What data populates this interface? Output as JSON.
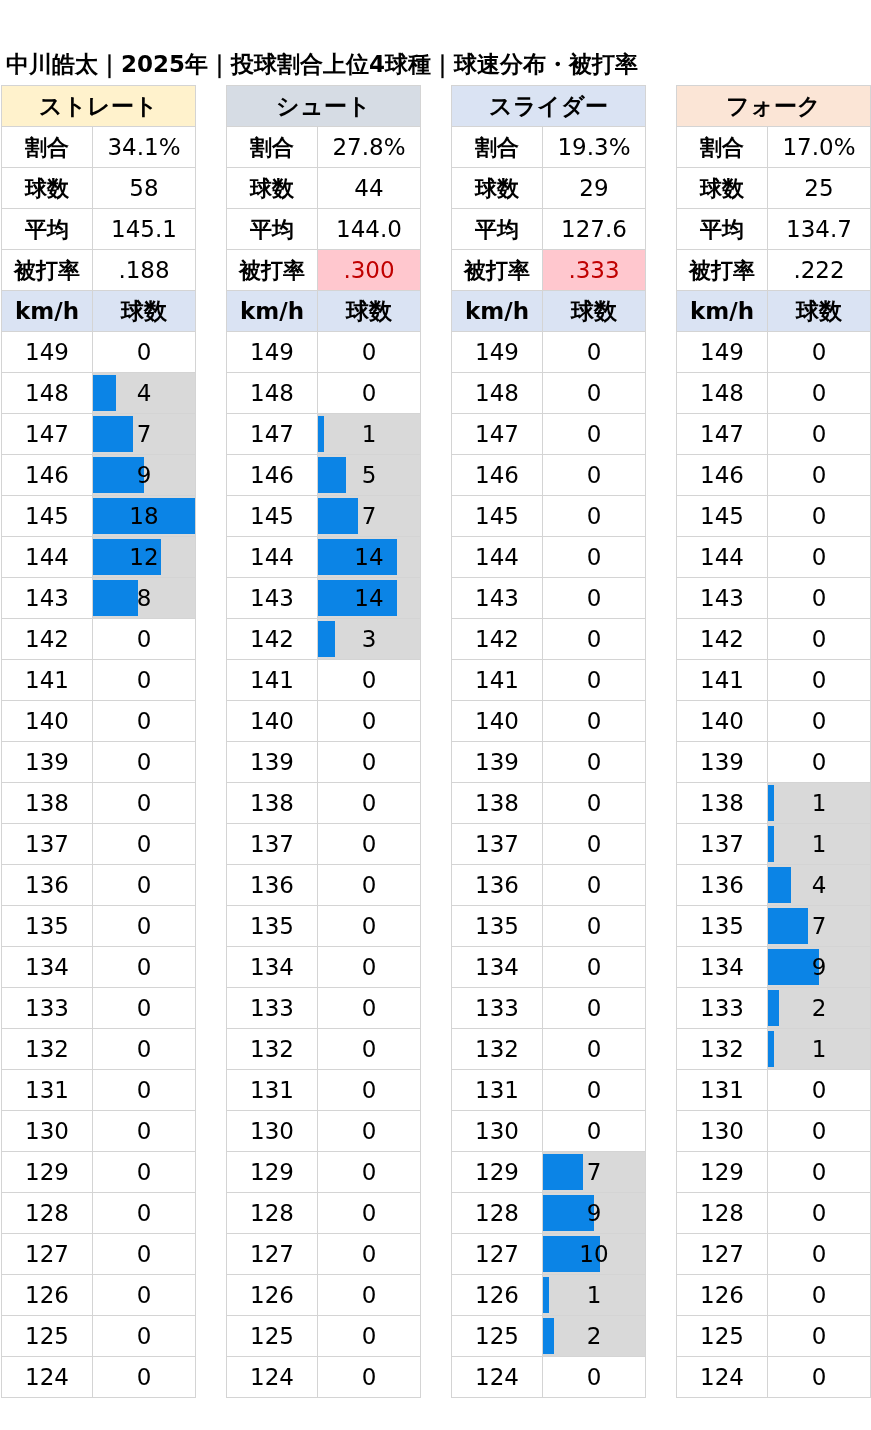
{
  "title": "中川皓太｜2025年｜投球割合上位4球種｜球速分布・被打率",
  "pitches": [
    {
      "name": "ストレート",
      "color": "#fff2cc",
      "stats": [
        {
          "label": "割合",
          "value": "34.1%",
          "highlight": false
        },
        {
          "label": "球数",
          "value": "58",
          "highlight": false
        },
        {
          "label": "平均",
          "value": "145.1",
          "highlight": false
        },
        {
          "label": "被打率",
          "value": ".188",
          "highlight": false
        }
      ],
      "columns": [
        "km/h",
        "球数"
      ],
      "rows": [
        {
          "speed": "149",
          "count": "0"
        },
        {
          "speed": "148",
          "count": "4",
          "level": 0.222
        },
        {
          "speed": "147",
          "count": "7",
          "level": 0.389
        },
        {
          "speed": "146",
          "count": "9",
          "level": 0.5
        },
        {
          "speed": "145",
          "count": "18",
          "level": 1
        },
        {
          "speed": "144",
          "count": "12",
          "level": 0.667
        },
        {
          "speed": "143",
          "count": "8",
          "level": 0.444
        },
        {
          "speed": "142",
          "count": "0"
        },
        {
          "speed": "141",
          "count": "0"
        },
        {
          "speed": "140",
          "count": "0"
        },
        {
          "speed": "139",
          "count": "0"
        },
        {
          "speed": "138",
          "count": "0"
        },
        {
          "speed": "137",
          "count": "0"
        },
        {
          "speed": "136",
          "count": "0"
        },
        {
          "speed": "135",
          "count": "0"
        },
        {
          "speed": "134",
          "count": "0"
        },
        {
          "speed": "133",
          "count": "0"
        },
        {
          "speed": "132",
          "count": "0"
        },
        {
          "speed": "131",
          "count": "0"
        },
        {
          "speed": "130",
          "count": "0"
        },
        {
          "speed": "129",
          "count": "0"
        },
        {
          "speed": "128",
          "count": "0"
        },
        {
          "speed": "127",
          "count": "0"
        },
        {
          "speed": "126",
          "count": "0"
        },
        {
          "speed": "125",
          "count": "0"
        },
        {
          "speed": "124",
          "count": "0"
        }
      ]
    },
    {
      "name": "シュート",
      "color": "#d6dce4",
      "stats": [
        {
          "label": "割合",
          "value": "27.8%",
          "highlight": false
        },
        {
          "label": "球数",
          "value": "44",
          "highlight": false
        },
        {
          "label": "平均",
          "value": "144.0",
          "highlight": false
        },
        {
          "label": "被打率",
          "value": ".300",
          "highlight": true
        }
      ],
      "columns": [
        "km/h",
        "球数"
      ],
      "rows": [
        {
          "speed": "149",
          "count": "0"
        },
        {
          "speed": "148",
          "count": "0"
        },
        {
          "speed": "147",
          "count": "1",
          "level": 0.056
        },
        {
          "speed": "146",
          "count": "5",
          "level": 0.278
        },
        {
          "speed": "145",
          "count": "7",
          "level": 0.389
        },
        {
          "speed": "144",
          "count": "14",
          "level": 0.778
        },
        {
          "speed": "143",
          "count": "14",
          "level": 0.778
        },
        {
          "speed": "142",
          "count": "3",
          "level": 0.167
        },
        {
          "speed": "141",
          "count": "0"
        },
        {
          "speed": "140",
          "count": "0"
        },
        {
          "speed": "139",
          "count": "0"
        },
        {
          "speed": "138",
          "count": "0"
        },
        {
          "speed": "137",
          "count": "0"
        },
        {
          "speed": "136",
          "count": "0"
        },
        {
          "speed": "135",
          "count": "0"
        },
        {
          "speed": "134",
          "count": "0"
        },
        {
          "speed": "133",
          "count": "0"
        },
        {
          "speed": "132",
          "count": "0"
        },
        {
          "speed": "131",
          "count": "0"
        },
        {
          "speed": "130",
          "count": "0"
        },
        {
          "speed": "129",
          "count": "0"
        },
        {
          "speed": "128",
          "count": "0"
        },
        {
          "speed": "127",
          "count": "0"
        },
        {
          "speed": "126",
          "count": "0"
        },
        {
          "speed": "125",
          "count": "0"
        },
        {
          "speed": "124",
          "count": "0"
        }
      ]
    },
    {
      "name": "スライダー",
      "color": "#dae3f3",
      "stats": [
        {
          "label": "割合",
          "value": "19.3%",
          "highlight": false
        },
        {
          "label": "球数",
          "value": "29",
          "highlight": false
        },
        {
          "label": "平均",
          "value": "127.6",
          "highlight": false
        },
        {
          "label": "被打率",
          "value": ".333",
          "highlight": true
        }
      ],
      "columns": [
        "km/h",
        "球数"
      ],
      "rows": [
        {
          "speed": "149",
          "count": "0"
        },
        {
          "speed": "148",
          "count": "0"
        },
        {
          "speed": "147",
          "count": "0"
        },
        {
          "speed": "146",
          "count": "0"
        },
        {
          "speed": "145",
          "count": "0"
        },
        {
          "speed": "144",
          "count": "0"
        },
        {
          "speed": "143",
          "count": "0"
        },
        {
          "speed": "142",
          "count": "0"
        },
        {
          "speed": "141",
          "count": "0"
        },
        {
          "speed": "140",
          "count": "0"
        },
        {
          "speed": "139",
          "count": "0"
        },
        {
          "speed": "138",
          "count": "0"
        },
        {
          "speed": "137",
          "count": "0"
        },
        {
          "speed": "136",
          "count": "0"
        },
        {
          "speed": "135",
          "count": "0"
        },
        {
          "speed": "134",
          "count": "0"
        },
        {
          "speed": "133",
          "count": "0"
        },
        {
          "speed": "132",
          "count": "0"
        },
        {
          "speed": "131",
          "count": "0"
        },
        {
          "speed": "130",
          "count": "0"
        },
        {
          "speed": "129",
          "count": "7",
          "level": 0.389
        },
        {
          "speed": "128",
          "count": "9",
          "level": 0.5
        },
        {
          "speed": "127",
          "count": "10",
          "level": 0.556
        },
        {
          "speed": "126",
          "count": "1",
          "level": 0.056
        },
        {
          "speed": "125",
          "count": "2",
          "level": 0.111
        },
        {
          "speed": "124",
          "count": "0"
        }
      ]
    },
    {
      "name": "フォーク",
      "color": "#fbe5d6",
      "stats": [
        {
          "label": "割合",
          "value": "17.0%",
          "highlight": false
        },
        {
          "label": "球数",
          "value": "25",
          "highlight": false
        },
        {
          "label": "平均",
          "value": "134.7",
          "highlight": false
        },
        {
          "label": "被打率",
          "value": ".222",
          "highlight": false
        }
      ],
      "columns": [
        "km/h",
        "球数"
      ],
      "rows": [
        {
          "speed": "149",
          "count": "0"
        },
        {
          "speed": "148",
          "count": "0"
        },
        {
          "speed": "147",
          "count": "0"
        },
        {
          "speed": "146",
          "count": "0"
        },
        {
          "speed": "145",
          "count": "0"
        },
        {
          "speed": "144",
          "count": "0"
        },
        {
          "speed": "143",
          "count": "0"
        },
        {
          "speed": "142",
          "count": "0"
        },
        {
          "speed": "141",
          "count": "0"
        },
        {
          "speed": "140",
          "count": "0"
        },
        {
          "speed": "139",
          "count": "0"
        },
        {
          "speed": "138",
          "count": "1",
          "level": 0.056
        },
        {
          "speed": "137",
          "count": "1",
          "level": 0.056
        },
        {
          "speed": "136",
          "count": "4",
          "level": 0.222
        },
        {
          "speed": "135",
          "count": "7",
          "level": 0.389
        },
        {
          "speed": "134",
          "count": "9",
          "level": 0.5
        },
        {
          "speed": "133",
          "count": "2",
          "level": 0.111
        },
        {
          "speed": "132",
          "count": "1",
          "level": 0.056
        },
        {
          "speed": "131",
          "count": "0"
        },
        {
          "speed": "130",
          "count": "0"
        },
        {
          "speed": "129",
          "count": "0"
        },
        {
          "speed": "128",
          "count": "0"
        },
        {
          "speed": "127",
          "count": "0"
        },
        {
          "speed": "126",
          "count": "0"
        },
        {
          "speed": "125",
          "count": "0"
        },
        {
          "speed": "124",
          "count": "0"
        }
      ]
    }
  ]
}
